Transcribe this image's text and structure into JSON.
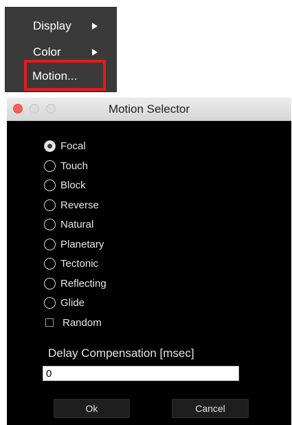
{
  "menu": {
    "items": [
      {
        "label": "Display",
        "has_submenu": true
      },
      {
        "label": "Color",
        "has_submenu": true
      },
      {
        "label": "Motion...",
        "has_submenu": false,
        "highlighted": true
      }
    ],
    "highlight_color": "#e61a1a"
  },
  "dialog": {
    "title": "Motion Selector",
    "options": [
      {
        "label": "Focal",
        "selected": true
      },
      {
        "label": "Touch",
        "selected": false
      },
      {
        "label": "Block",
        "selected": false
      },
      {
        "label": "Reverse",
        "selected": false
      },
      {
        "label": "Natural",
        "selected": false
      },
      {
        "label": "Planetary",
        "selected": false
      },
      {
        "label": "Tectonic",
        "selected": false
      },
      {
        "label": "Reflecting",
        "selected": false
      },
      {
        "label": "Glide",
        "selected": false
      }
    ],
    "random": {
      "label": "Random",
      "checked": false
    },
    "delay": {
      "label": "Delay Compensation [msec]",
      "value": "0"
    },
    "buttons": {
      "ok": "Ok",
      "cancel": "Cancel"
    }
  }
}
